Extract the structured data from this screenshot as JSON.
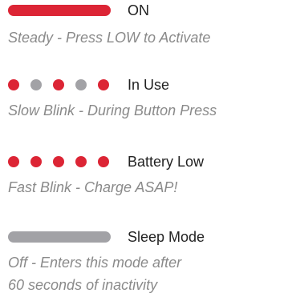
{
  "colors": {
    "active_red": "#dc2535",
    "inactive_gray": "#a2a2a6",
    "label_text": "#222222",
    "description_text": "#8a8a8a"
  },
  "legend": [
    {
      "state": "ON",
      "description": "Steady - Press LOW to Activate",
      "indicator": "solid-bar",
      "indicator_color": "red",
      "dots": []
    },
    {
      "state": "In Use",
      "description": "Slow Blink - During Button Press",
      "indicator": "dots",
      "dots": [
        "red",
        "gray",
        "red",
        "gray",
        "red"
      ]
    },
    {
      "state": "Battery Low",
      "description": "Fast Blink - Charge ASAP!",
      "indicator": "dots",
      "dots": [
        "red",
        "red",
        "red",
        "red",
        "red"
      ]
    },
    {
      "state": "Sleep Mode",
      "description_lines": [
        "Off - Enters this mode after",
        "60 seconds of inactivity"
      ],
      "indicator": "solid-bar",
      "indicator_color": "gray",
      "dots": []
    }
  ]
}
